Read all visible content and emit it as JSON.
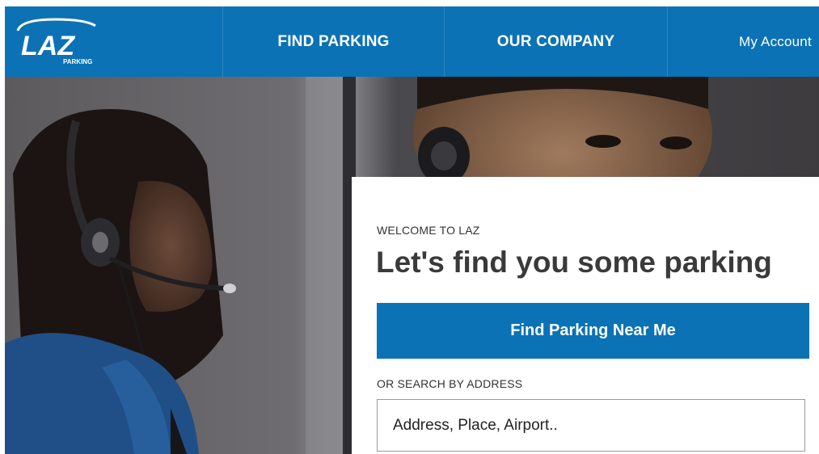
{
  "brand": {
    "logo_text": "LAZ",
    "logo_sub": "PARKING",
    "color": "#0b72b5"
  },
  "nav": {
    "find_parking": "FIND PARKING",
    "our_company": "OUR COMPANY",
    "my_account": "My Account"
  },
  "hero": {
    "eyebrow": "WELCOME TO LAZ",
    "headline": "Let's find you some parking",
    "cta_label": "Find Parking Near Me",
    "or_label": "OR SEARCH BY ADDRESS",
    "address_placeholder": "Address, Place, Airport.."
  }
}
